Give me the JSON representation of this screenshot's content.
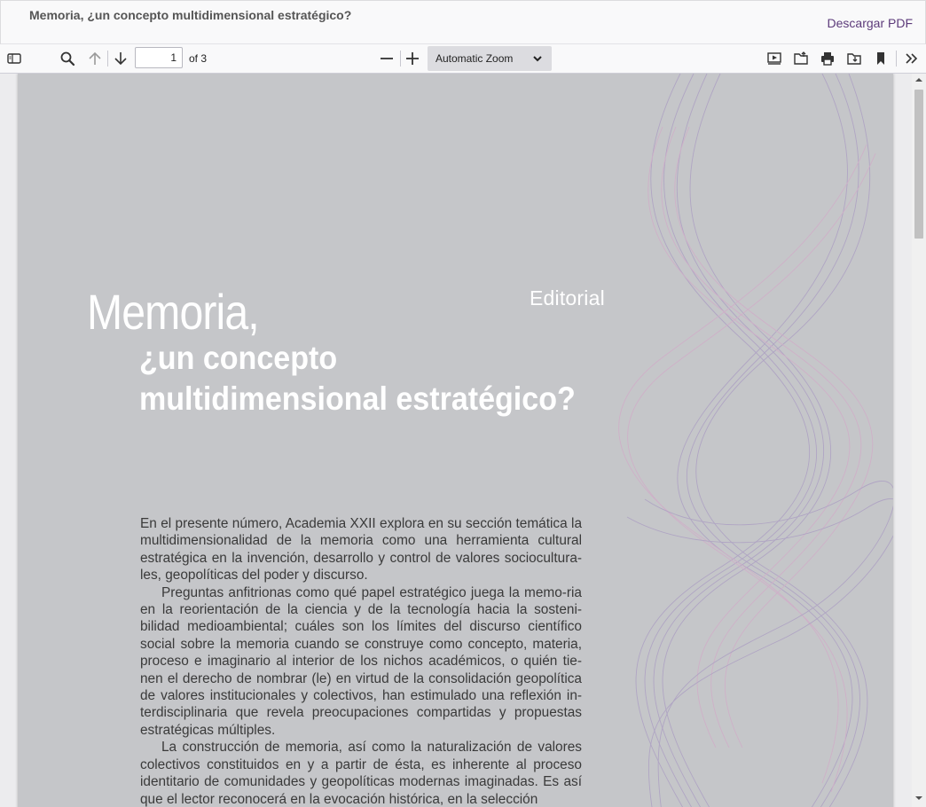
{
  "header": {
    "title": "Memoria, ¿un concepto multidimensional estratégico?",
    "download_label": "Descargar PDF"
  },
  "toolbar": {
    "icons": [
      "sidebar-toggle-icon",
      "search-icon",
      "arrow-up-icon",
      "arrow-down-icon",
      "zoom-out-icon",
      "zoom-in-icon",
      "presentation-icon",
      "open-file-icon",
      "print-icon",
      "download-icon",
      "bookmark-icon",
      "tools-chevron-icon"
    ],
    "page_number": "1",
    "page_count_text": "of 3",
    "zoom_label": "Automatic Zoom"
  },
  "document": {
    "section_label": "Editorial",
    "title_line1": "Memoria,",
    "title_line2": "¿un concepto",
    "title_line3": "multidimensional estratégico?",
    "paragraphs": [
      "En el presente número, Academia XXII explora en su sección temática la multidimensionalidad de la memoria como una herramienta cultural estratégica en la invención, desarrollo y control de valores sociocultura-les, geopolíticas del poder y discurso.",
      "Preguntas anfitrionas como qué papel estratégico juega la memo-ria en la reorientación de la ciencia y de la tecnología hacia la sosteni-bilidad medioambiental; cuáles son los límites del discurso científico social sobre la memoria cuando se construye como concepto, materia, proceso e imaginario al interior de los nichos académicos, o quién tie-nen el derecho de nombrar (le) en virtud de la consolidación geopolítica de valores institucionales y colectivos, han estimulado una reflexión in-terdisciplinaria que revela preocupaciones compartidas y propuestas estratégicas múltiples.",
      "La construcción de memoria, así como la naturalización de valores colectivos constituidos en y a partir de ésta, es inherente al proceso identitario de comunidades y geopolíticas modernas imaginadas. Es así que el lector reconocerá en la evocación histórica, en la selección"
    ]
  },
  "colors": {
    "accent_link": "#5c3a7a",
    "page_background": "#c5c6c9",
    "wave_purple": "#a99ac2",
    "wave_pink": "#d2a9c8"
  }
}
